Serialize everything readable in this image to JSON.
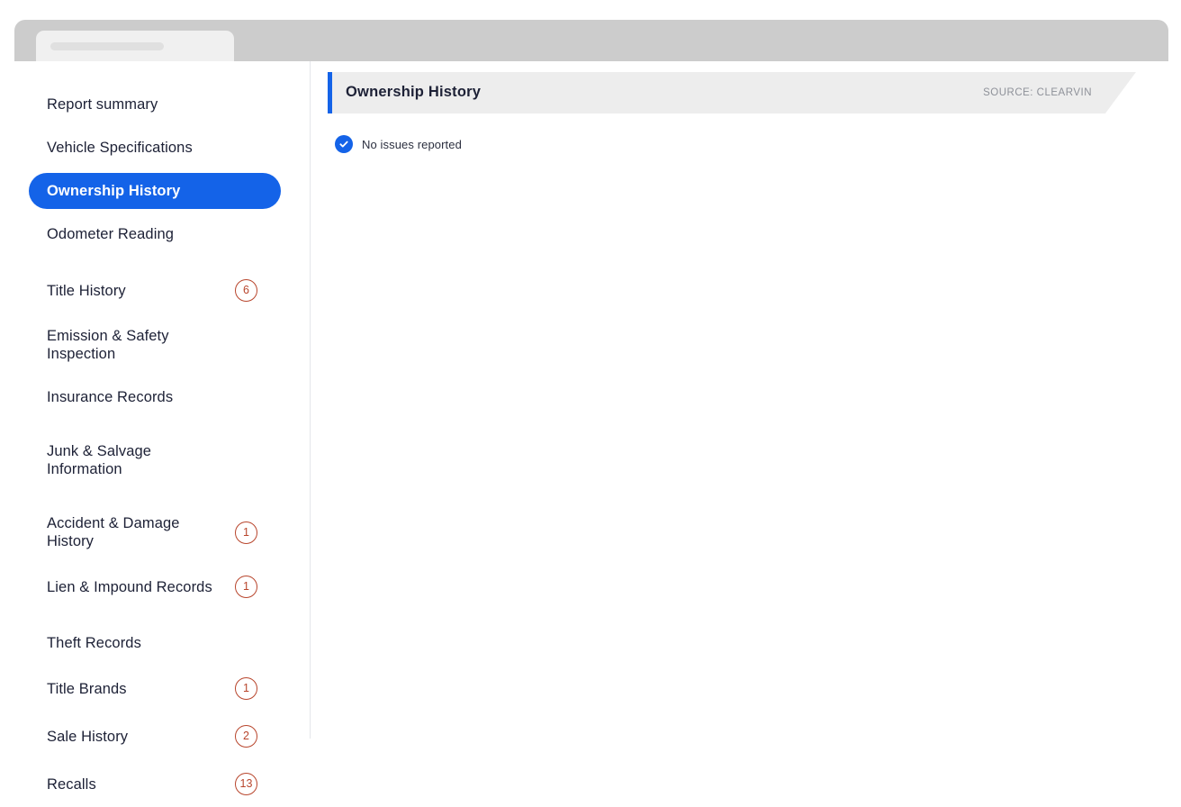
{
  "browser": {
    "tab_placeholder": ""
  },
  "sidebar": {
    "items": [
      {
        "label": "Report summary",
        "badge": "",
        "active": false,
        "gap": "sm"
      },
      {
        "label": "Vehicle Specifications",
        "badge": "",
        "active": false,
        "gap": "sm"
      },
      {
        "label": "Ownership History",
        "badge": "",
        "active": true,
        "gap": "sm"
      },
      {
        "label": "Odometer Reading",
        "badge": "",
        "active": false,
        "gap": "md"
      },
      {
        "label": "Title History",
        "badge": "6",
        "active": false,
        "gap": "sm"
      },
      {
        "label": "Emission & Safety Inspection",
        "badge": "",
        "active": false,
        "gap": "sm"
      },
      {
        "label": "Insurance Records",
        "badge": "",
        "active": false,
        "gap": "md"
      },
      {
        "label": "Junk & Salvage Information",
        "badge": "",
        "active": false,
        "gap": "md"
      },
      {
        "label": "Accident & Damage History",
        "badge": "1",
        "active": false,
        "gap": "sm"
      },
      {
        "label": "Lien & Impound Records",
        "badge": "1",
        "active": false,
        "gap": "md"
      },
      {
        "label": "Theft Records",
        "badge": "",
        "active": false,
        "gap": "sm"
      },
      {
        "label": "Title Brands",
        "badge": "1",
        "active": false,
        "gap": "sm"
      },
      {
        "label": "Sale History",
        "badge": "2",
        "active": false,
        "gap": "sm"
      },
      {
        "label": "Recalls",
        "badge": "13",
        "active": false,
        "gap": "sm"
      }
    ]
  },
  "section": {
    "title": "Ownership History",
    "source": "SOURCE: CLEARVIN",
    "status_text": "No issues reported",
    "status_icon": "check-circle-icon"
  },
  "colors": {
    "accent_blue": "#1463e8",
    "badge_rust": "#b8452c",
    "header_gray": "#ededed",
    "chrome_gray": "#cccccc",
    "text_navy": "#1d2136"
  }
}
